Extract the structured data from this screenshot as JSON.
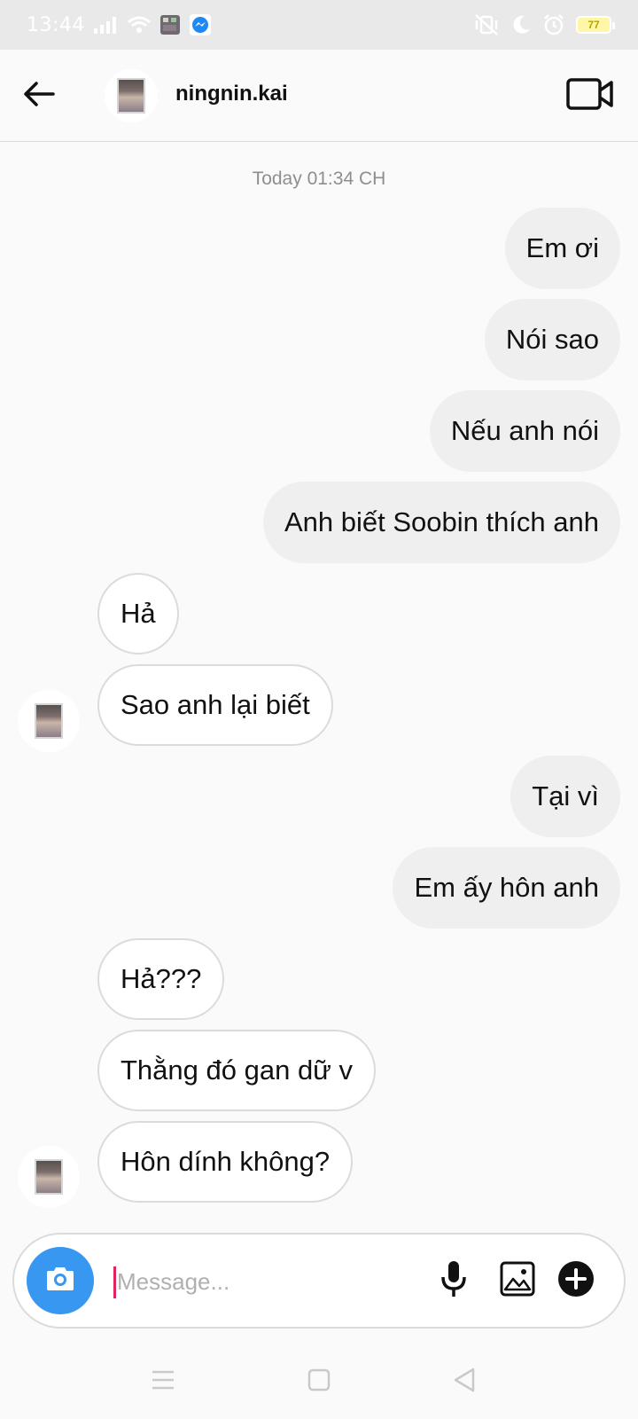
{
  "status_bar": {
    "time": "13:44",
    "battery_level": "77",
    "icons": [
      "signal-icon",
      "wifi-icon",
      "app-thumbnail-icon",
      "messenger-icon",
      "vibrate-off-icon",
      "moon-icon",
      "alarm-icon",
      "battery-icon"
    ]
  },
  "header": {
    "username": "ningnin.kai",
    "icons": [
      "back-arrow-icon",
      "video-call-icon"
    ]
  },
  "chat": {
    "timestamp": "Today 01:34 CH",
    "messages": [
      {
        "side": "out",
        "text": "Em ơi"
      },
      {
        "side": "out",
        "text": "Nói sao"
      },
      {
        "side": "out",
        "text": "Nếu anh nói"
      },
      {
        "side": "out",
        "text": "Anh biết Soobin thích anh"
      },
      {
        "side": "in",
        "text": "Hả"
      },
      {
        "side": "in",
        "text": "Sao anh lại biết"
      },
      {
        "side": "out",
        "text": "Tại vì"
      },
      {
        "side": "out",
        "text": "Em ấy hôn anh"
      },
      {
        "side": "in",
        "text": "Hả???"
      },
      {
        "side": "in",
        "text": "Thằng đó gan dữ v"
      },
      {
        "side": "in",
        "text": "Hôn dính không?"
      }
    ]
  },
  "composer": {
    "placeholder": "Message...",
    "value": "",
    "icons": [
      "camera-icon",
      "microphone-icon",
      "gallery-icon",
      "plus-icon"
    ]
  },
  "navbar": {
    "icons": [
      "menu-icon",
      "home-square-icon",
      "back-triangle-icon"
    ]
  },
  "colors": {
    "accent": "#3897f0",
    "outgoing_bubble": "#efefef",
    "incoming_border": "#dbdbdb",
    "background": "#fafafa"
  }
}
